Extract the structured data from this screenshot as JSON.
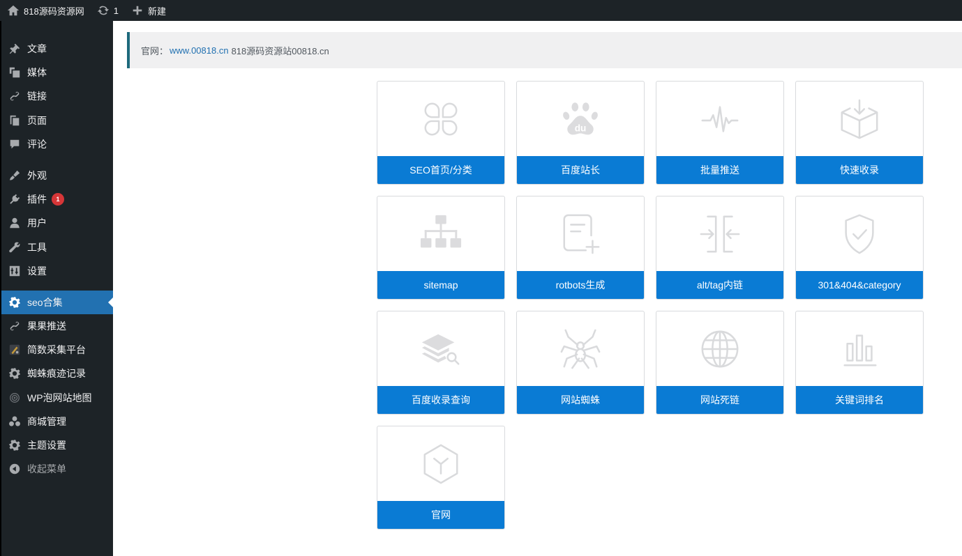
{
  "adminbar": {
    "site_name": "818源码资源网",
    "updates_count": "1",
    "new_label": "新建"
  },
  "sidebar": {
    "items": [
      {
        "label": "文章",
        "icon": "pin-icon"
      },
      {
        "label": "媒体",
        "icon": "media-icon"
      },
      {
        "label": "链接",
        "icon": "link-icon"
      },
      {
        "label": "页面",
        "icon": "page-icon"
      },
      {
        "label": "评论",
        "icon": "comment-icon"
      },
      {
        "label": "外观",
        "icon": "brush-icon"
      },
      {
        "label": "插件",
        "icon": "plugin-icon",
        "badge": "1"
      },
      {
        "label": "用户",
        "icon": "user-icon"
      },
      {
        "label": "工具",
        "icon": "wrench-icon"
      },
      {
        "label": "设置",
        "icon": "settings-icon"
      },
      {
        "label": "seo合集",
        "icon": "gear-icon",
        "current": true
      },
      {
        "label": "果果推送",
        "icon": "link-icon"
      },
      {
        "label": "简数采集平台",
        "icon": "collector-icon"
      },
      {
        "label": "蜘蛛痕迹记录",
        "icon": "gear-icon"
      },
      {
        "label": "WP泡网站地图",
        "icon": "sitemap-plugin-icon"
      },
      {
        "label": "商城管理",
        "icon": "groups-icon"
      },
      {
        "label": "主题设置",
        "icon": "gear-icon"
      },
      {
        "label": "收起菜单",
        "icon": "collapse-icon"
      }
    ]
  },
  "notice": {
    "prefix": "官网：",
    "link_text": "www.00818.cn",
    "suffix": "818源码资源站00818.cn"
  },
  "tiles": [
    {
      "label": "SEO首页/分类",
      "icon": "clover-icon"
    },
    {
      "label": "百度站长",
      "icon": "baidu-paw-icon"
    },
    {
      "label": "批量推送",
      "icon": "pulse-icon"
    },
    {
      "label": "快速收录",
      "icon": "box-download-icon"
    },
    {
      "label": "sitemap",
      "icon": "sitemap-icon"
    },
    {
      "label": "rotbots生成",
      "icon": "doc-add-icon"
    },
    {
      "label": "alt/tag内链",
      "icon": "merge-arrows-icon"
    },
    {
      "label": "301&404&category",
      "icon": "shield-check-icon"
    },
    {
      "label": "百度收录查询",
      "icon": "layers-search-icon"
    },
    {
      "label": "网站蜘蛛",
      "icon": "spider-icon"
    },
    {
      "label": "网站死链",
      "icon": "globe-icon"
    },
    {
      "label": "关键词排名",
      "icon": "bar-chart-icon"
    },
    {
      "label": "官网",
      "icon": "cube-y-icon"
    }
  ]
}
